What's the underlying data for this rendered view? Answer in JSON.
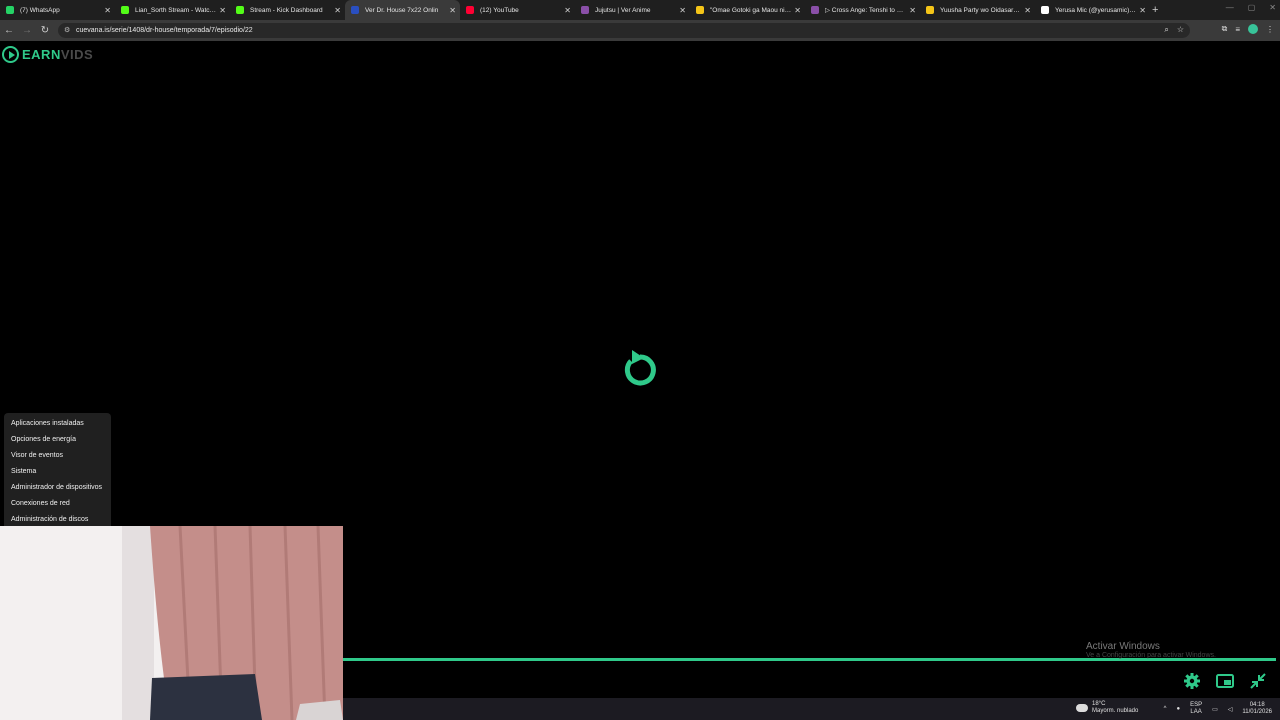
{
  "browser": {
    "tabs": [
      {
        "label": "(7) WhatsApp",
        "color": "#25d366",
        "active": false
      },
      {
        "label": "Lian_Sorth Stream - Watch Li",
        "color": "#53fc18",
        "active": false
      },
      {
        "label": "Stream - Kick Dashboard",
        "color": "#53fc18",
        "active": false
      },
      {
        "label": "Ver Dr. House 7x22 Onlin",
        "color": "#2a4fc0",
        "active": true
      },
      {
        "label": "(12) YouTube",
        "color": "#ff0033",
        "active": false
      },
      {
        "label": "Jujutsu | Ver Anime",
        "color": "#8a4fa8",
        "active": false
      },
      {
        "label": "\"Omae Gotoki ga Maou ni Ka",
        "color": "#f5c518",
        "active": false
      },
      {
        "label": "▷ Cross Ange: Tenshi to Ryuu",
        "color": "#8a4fa8",
        "active": false
      },
      {
        "label": "Yuusha Party wo Oidasareta k",
        "color": "#f5c518",
        "active": false
      },
      {
        "label": "Yerusa Mic (@yerusamic) | Ti",
        "color": "#ffffff",
        "active": false
      }
    ],
    "url": "cuevana.is/serie/1408/dr-house/temporada/7/episodio/22"
  },
  "player": {
    "logo_earn": "EARN",
    "logo_vids": "VIDS",
    "accent": "#2fc98a",
    "progress": 1.0
  },
  "context_menu": {
    "items": [
      "Aplicaciones instaladas",
      "Opciones de energía",
      "Visor de eventos",
      "Sistema",
      "Administrador de dispositivos",
      "Conexiones de red",
      "Administración de discos"
    ]
  },
  "watermark": {
    "title": "Activar Windows",
    "subtitle": "Ve a Configuración para activar Windows."
  },
  "taskbar": {
    "temperature": "18°C",
    "weather": "Mayorm. nublado",
    "lang1": "ESP",
    "lang2": "LAA",
    "time": "04:18",
    "date": "11/01/2026"
  }
}
